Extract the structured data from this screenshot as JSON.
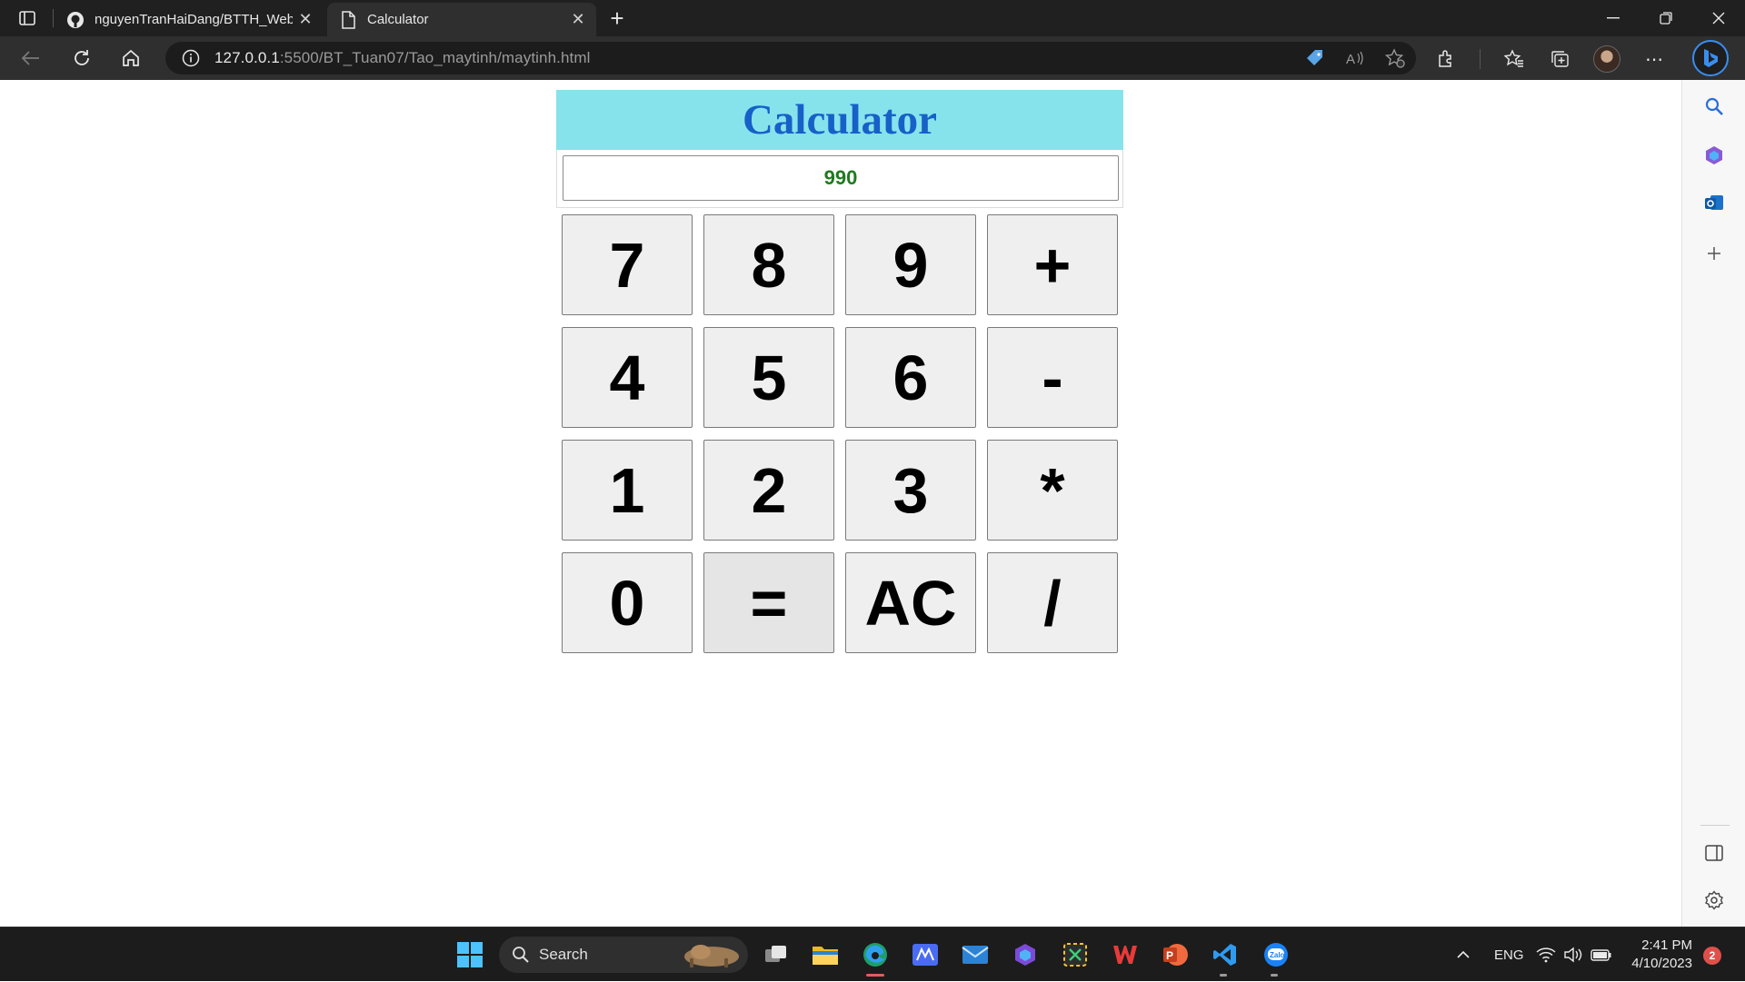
{
  "browser": {
    "tabs": [
      {
        "title": "nguyenTranHaiDang/BTTH_Web",
        "icon": "github-icon",
        "active": false
      },
      {
        "title": "Calculator",
        "icon": "page-icon",
        "active": true
      }
    ],
    "url_host": "127.0.0.1",
    "url_rest": ":5500/BT_Tuan07/Tao_maytinh/maytinh.html"
  },
  "calculator": {
    "title": "Calculator",
    "display_value": "990",
    "keys": [
      "7",
      "8",
      "9",
      "+",
      "4",
      "5",
      "6",
      "-",
      "1",
      "2",
      "3",
      "*",
      "0",
      "=",
      "AC",
      "/"
    ]
  },
  "taskbar": {
    "search_label": "Search",
    "language": "ENG",
    "time": "2:41 PM",
    "date": "4/10/2023",
    "notification_count": "2"
  },
  "colors": {
    "header_bg": "#86e3ec",
    "title_color": "#1660c8",
    "display_text": "#1f7a1f",
    "key_bg": "#efefef"
  }
}
